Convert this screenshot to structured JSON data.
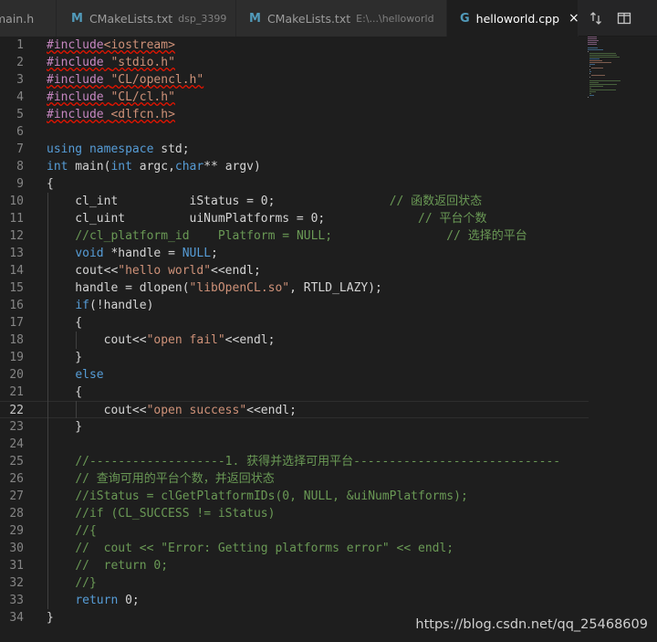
{
  "tabs": [
    {
      "label": "main.h",
      "desc": "",
      "icon": "",
      "active": false
    },
    {
      "label": "CMakeLists.txt",
      "desc": "dsp_3399",
      "icon": "cmake-icon",
      "active": false
    },
    {
      "label": "CMakeLists.txt",
      "desc": "E:\\...\\helloworld",
      "icon": "cmake-icon",
      "active": false
    },
    {
      "label": "helloworld.cpp",
      "desc": "",
      "icon": "cpp-icon",
      "active": true
    }
  ],
  "toolbar": {
    "compare_icon": "compare-changes-icon",
    "split_icon": "split-editor-icon",
    "close_glyph": "×"
  },
  "editor": {
    "current_line": 22,
    "lines": [
      {
        "n": "1",
        "t": "#include<iostream>"
      },
      {
        "n": "2",
        "t": "#include \"stdio.h\""
      },
      {
        "n": "3",
        "t": "#include \"CL/opencl.h\""
      },
      {
        "n": "4",
        "t": "#include \"CL/cl.h\""
      },
      {
        "n": "5",
        "t": "#include <dlfcn.h>"
      },
      {
        "n": "6",
        "t": ""
      },
      {
        "n": "7",
        "t": "using namespace std;"
      },
      {
        "n": "8",
        "t": "int main(int argc,char** argv)"
      },
      {
        "n": "9",
        "t": "{"
      },
      {
        "n": "10",
        "t": "    cl_int          iStatus = 0;                // 函数返回状态"
      },
      {
        "n": "11",
        "t": "    cl_uint         uiNumPlatforms = 0;             // 平台个数"
      },
      {
        "n": "12",
        "t": "    //cl_platform_id    Platform = NULL;                // 选择的平台"
      },
      {
        "n": "13",
        "t": "    void *handle = NULL;"
      },
      {
        "n": "14",
        "t": "    cout<<\"hello world\"<<endl;"
      },
      {
        "n": "15",
        "t": "    handle = dlopen(\"libOpenCL.so\", RTLD_LAZY);"
      },
      {
        "n": "16",
        "t": "    if(!handle)"
      },
      {
        "n": "17",
        "t": "    {"
      },
      {
        "n": "18",
        "t": "        cout<<\"open fail\"<<endl;"
      },
      {
        "n": "19",
        "t": "    }"
      },
      {
        "n": "20",
        "t": "    else"
      },
      {
        "n": "21",
        "t": "    {"
      },
      {
        "n": "22",
        "t": "        cout<<\"open success\"<<endl;"
      },
      {
        "n": "23",
        "t": "    }"
      },
      {
        "n": "24",
        "t": ""
      },
      {
        "n": "25",
        "t": "    //-------------------1. 获得并选择可用平台-----------------------------"
      },
      {
        "n": "26",
        "t": "    // 查询可用的平台个数，并返回状态"
      },
      {
        "n": "27",
        "t": "    //iStatus = clGetPlatformIDs(0, NULL, &uiNumPlatforms);"
      },
      {
        "n": "28",
        "t": "    //if (CL_SUCCESS != iStatus)"
      },
      {
        "n": "29",
        "t": "    //{"
      },
      {
        "n": "30",
        "t": "    //  cout << \"Error: Getting platforms error\" << endl;"
      },
      {
        "n": "31",
        "t": "    //  return 0;"
      },
      {
        "n": "32",
        "t": "    //}"
      },
      {
        "n": "33",
        "t": "    return 0;"
      },
      {
        "n": "34",
        "t": "}"
      }
    ]
  },
  "watermark": "https://blog.csdn.net/qq_25468609",
  "colors": {
    "background": "#1e1e1e",
    "keyword": "#569cd6",
    "string": "#ce9178",
    "comment": "#6a9955",
    "preprocessor": "#c586c0",
    "text": "#d4d4d4",
    "squiggle": "#e51400"
  }
}
